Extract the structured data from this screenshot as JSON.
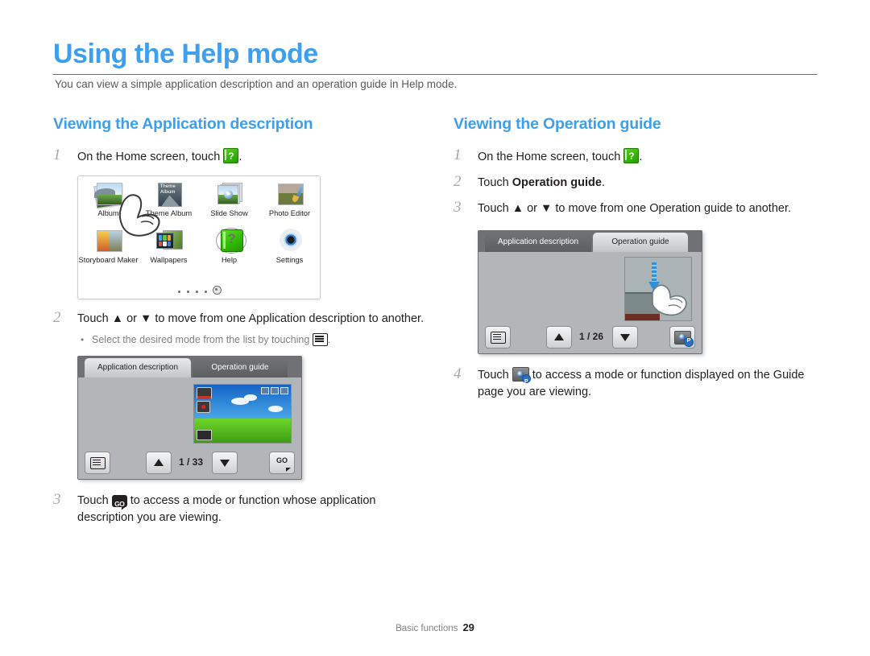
{
  "page": {
    "title": "Using the Help mode",
    "intro": "You can view a simple application description and an operation guide in Help mode.",
    "footer_section": "Basic functions",
    "footer_page": "29",
    "accent_color": "#3c9ff0"
  },
  "left_column": {
    "heading": "Viewing the Application description",
    "steps": [
      {
        "num": "1",
        "text_before": "On the Home screen, touch",
        "icon": "help-icon",
        "text_after": "."
      },
      {
        "num": "2",
        "text": "Touch ▲ or ▼ to move from one Application description to another.",
        "bullet": "Select the desired mode from the list by touching"
      },
      {
        "num": "3",
        "text_before": "Touch",
        "icon": "go-icon",
        "text_after": "to access a mode or function whose application description you are viewing."
      }
    ],
    "home_screen": {
      "apps": [
        {
          "label": "Album",
          "icon": "album-icon"
        },
        {
          "label": "Theme Album",
          "icon": "theme-album-icon"
        },
        {
          "label": "Slide Show",
          "icon": "slide-show-icon"
        },
        {
          "label": "Photo Editor",
          "icon": "photo-editor-icon"
        },
        {
          "label": "Storyboard Maker",
          "icon": "storyboard-maker-icon"
        },
        {
          "label": "Wallpapers",
          "icon": "wallpapers-icon"
        },
        {
          "label": "Help",
          "icon": "help-app-icon"
        },
        {
          "label": "Settings",
          "icon": "settings-icon"
        }
      ]
    },
    "device": {
      "tab_active": "Application description",
      "tab_inactive": "Operation guide",
      "page_indicator": "1 / 33"
    }
  },
  "right_column": {
    "heading": "Viewing the Operation guide",
    "steps": [
      {
        "num": "1",
        "text_before": "On the Home screen, touch",
        "icon": "help-icon",
        "text_after": "."
      },
      {
        "num": "2",
        "text_before": "Touch",
        "bold": "Operation guide",
        "text_after": "."
      },
      {
        "num": "3",
        "text": "Touch ▲ or ▼ to move from one Operation guide to another."
      },
      {
        "num": "4",
        "text_before": "Touch",
        "icon": "camera-mode-icon",
        "text_after": "to access a mode or function displayed on the Guide page you are viewing."
      }
    ],
    "device": {
      "tab_inactive": "Application description",
      "tab_active": "Operation guide",
      "page_indicator": "1 / 26"
    }
  }
}
